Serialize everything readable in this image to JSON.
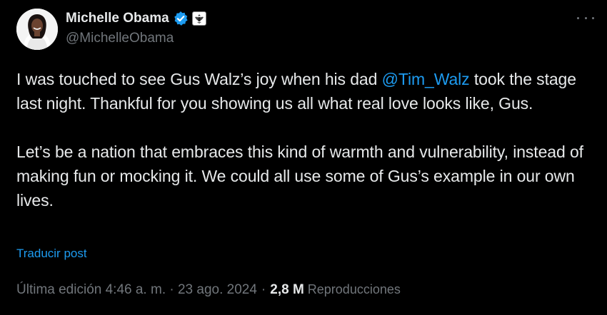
{
  "author": {
    "display_name": "Michelle Obama",
    "handle": "@MichelleObama",
    "verified": true,
    "affiliate_badge": "government-seal-icon"
  },
  "tweet": {
    "p1_before": "I was touched to see Gus Walz’s joy when his dad ",
    "p1_mention": "@Tim_Walz",
    "p1_after": " took the stage last night. Thankful for you showing us all what real love looks like, Gus.",
    "p2": "Let’s be a nation that embraces this kind of warmth and vulnerability, instead of making fun or mocking it. We could all use some of Gus’s example in our own lives."
  },
  "translate_label": "Traducir post",
  "meta": {
    "timestamp": "Última edición 4:46 a. m. · 23 ago. 2024",
    "separator": "·",
    "views_count": "2,8 M",
    "views_label": "Reproducciones"
  },
  "colors": {
    "background": "#000000",
    "text": "#e7e9ea",
    "secondary": "#71767b",
    "accent": "#1d9bf0"
  }
}
